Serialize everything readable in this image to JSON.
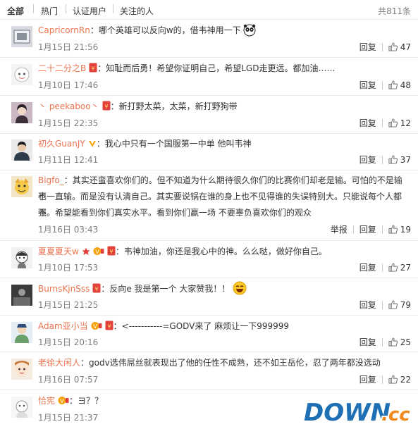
{
  "tabs": [
    {
      "label": "全部",
      "active": true
    },
    {
      "label": "热门",
      "active": false
    },
    {
      "label": "认证用户",
      "active": false
    },
    {
      "label": "关注的人",
      "active": false
    }
  ],
  "total_label": "共811条",
  "reply_label": "回复",
  "report_label": "举报",
  "comments": [
    {
      "user": "CapricornRn",
      "text": "：哪个英雄可以反向w的，借韦神用一下",
      "date": "1月15日 21:56",
      "likes": "47"
    },
    {
      "user": "二十二分之B",
      "text": "：知耻而后勇！希望你证明自己，希望LGD走更远。都加油……",
      "date": "1月10日 17:46",
      "likes": "48"
    },
    {
      "user": "丶 peekaboo丶",
      "text": "：新打野太菜，太菜，新打野狗带",
      "date": "1月15日 22:35",
      "likes": "12"
    },
    {
      "user": "初久GuanJY",
      "text": "：我心中只有一个国服第一中单 他叫韦神",
      "date": "1月11日 12:41",
      "likes": "37"
    },
    {
      "user": "Bigfo_",
      "text_lines": [
        "：其实还蛮喜欢你们的。但不知道为什么期待很久你们的比赛你们却老是输。可怕的不是输也",
        "不一直输。而是没有认清自己。其实要说锅在谁的身上也不见得谁的失误特别大。只能说每个人都不",
        "强。希望能看到你们真实水平。看到你们赢一场 不要辜负喜欢你们的观众"
      ],
      "date": "1月16日 03:43",
      "likes": "19"
    },
    {
      "user": "夏夏夏天w",
      "text": "：韦神加油，你还是我心中的神。么么哒，做好你自己。",
      "date": "1月10日 17:53",
      "likes": "27"
    },
    {
      "user": "BurnsKjnSss",
      "text": "：反向e 我是第一个 大家赞我！！",
      "date": "1月15日 21:25",
      "likes": "79"
    },
    {
      "user": "Adam亚小当",
      "text": "：<-----------=GODV来了 麻烦让一下999999",
      "date": "1月15日 20:16",
      "likes": "25"
    },
    {
      "user": "老徐大闲人",
      "text": "：godv选伟屌丝就表现出了他的任性不成熟，还不如王岳伦，忍了两年都没选动",
      "date": "1月16日 07:57",
      "likes": "22"
    },
    {
      "user": "恰宪",
      "text": "：ヨ？？",
      "date": "1月15日 21:37",
      "likes": ""
    }
  ],
  "watermark": {
    "main": "DOWN",
    "suffix": ".cc"
  },
  "colors": {
    "name": "#eb7350",
    "meta": "#808080",
    "border": "#ececec",
    "wm_blue": "#1f6fb5",
    "wm_orange": "#f08a1c"
  }
}
